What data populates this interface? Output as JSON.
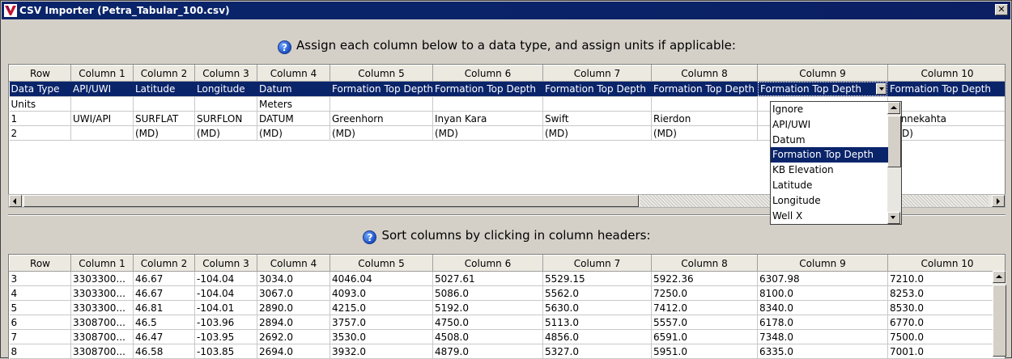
{
  "window": {
    "title": "CSV Importer (Petra_Tabular_100.csv)",
    "close_glyph": "✕"
  },
  "top_section": {
    "instruction": "Assign each column below to a data type, and assign units if applicable:",
    "headers": [
      "Row",
      "Column 1",
      "Column 2",
      "Column 3",
      "Column 4",
      "Column 5",
      "Column 6",
      "Column 7",
      "Column 8",
      "Column 9",
      "Column 10"
    ],
    "rows": [
      [
        "Data Type",
        "API/UWI",
        "Latitude",
        "Longitude",
        "Datum",
        "Formation Top Depth",
        "Formation Top Depth",
        "Formation Top Depth",
        "Formation Top Depth",
        "Formation Top Depth",
        "Formation Top Depth"
      ],
      [
        "Units",
        "",
        "",
        "",
        "Meters",
        "",
        "",
        "",
        "",
        "",
        ""
      ],
      [
        "1",
        "UWI/API",
        "SURFLAT",
        "SURFLON",
        "DATUM",
        "Greenhorn",
        "Inyan Kara",
        "Swift",
        "Rierdon",
        "",
        "Minnekahta"
      ],
      [
        "2",
        "",
        "(MD)",
        "(MD)",
        "(MD)",
        "(MD)",
        "(MD)",
        "(MD)",
        "(MD)",
        "",
        "(MD)"
      ]
    ]
  },
  "dropdown": {
    "selected_value": "Formation Top Depth",
    "options": [
      "Ignore",
      "API/UWI",
      "Datum",
      "Formation Top Depth",
      "KB Elevation",
      "Latitude",
      "Longitude",
      "Well X"
    ],
    "highlighted_index": 3
  },
  "bottom_section": {
    "instruction": "Sort columns by clicking in column headers:",
    "headers": [
      "Row",
      "Column 1",
      "Column 2",
      "Column 3",
      "Column 4",
      "Column 5",
      "Column 6",
      "Column 7",
      "Column 8",
      "Column 9",
      "Column 10"
    ],
    "rows": [
      [
        "3",
        "3303300...",
        "46.67",
        "-104.04",
        "3034.0",
        "4046.04",
        "5027.61",
        "5529.15",
        "5922.36",
        "6307.98",
        "7210.0"
      ],
      [
        "4",
        "3303300...",
        "46.67",
        "-104.04",
        "3067.0",
        "4093.0",
        "5086.0",
        "5562.0",
        "7250.0",
        "8100.0",
        "8253.0"
      ],
      [
        "5",
        "3303300...",
        "46.81",
        "-104.01",
        "2890.0",
        "4215.0",
        "5192.0",
        "5630.0",
        "7412.0",
        "8340.0",
        "8530.0"
      ],
      [
        "6",
        "3308700...",
        "46.5",
        "-103.96",
        "2894.0",
        "3757.0",
        "4750.0",
        "5113.0",
        "5557.0",
        "6178.0",
        "6770.0"
      ],
      [
        "7",
        "3308700...",
        "46.47",
        "-103.95",
        "2692.0",
        "3530.0",
        "4508.0",
        "4856.0",
        "6591.0",
        "7348.0",
        "7500.0"
      ],
      [
        "8",
        "3308700...",
        "46.58",
        "-103.85",
        "2694.0",
        "3932.0",
        "4879.0",
        "5327.0",
        "5951.0",
        "6335.0",
        "7001.0"
      ]
    ]
  },
  "colors": {
    "selection": "#0a246a",
    "chrome": "#d4d0c8"
  }
}
